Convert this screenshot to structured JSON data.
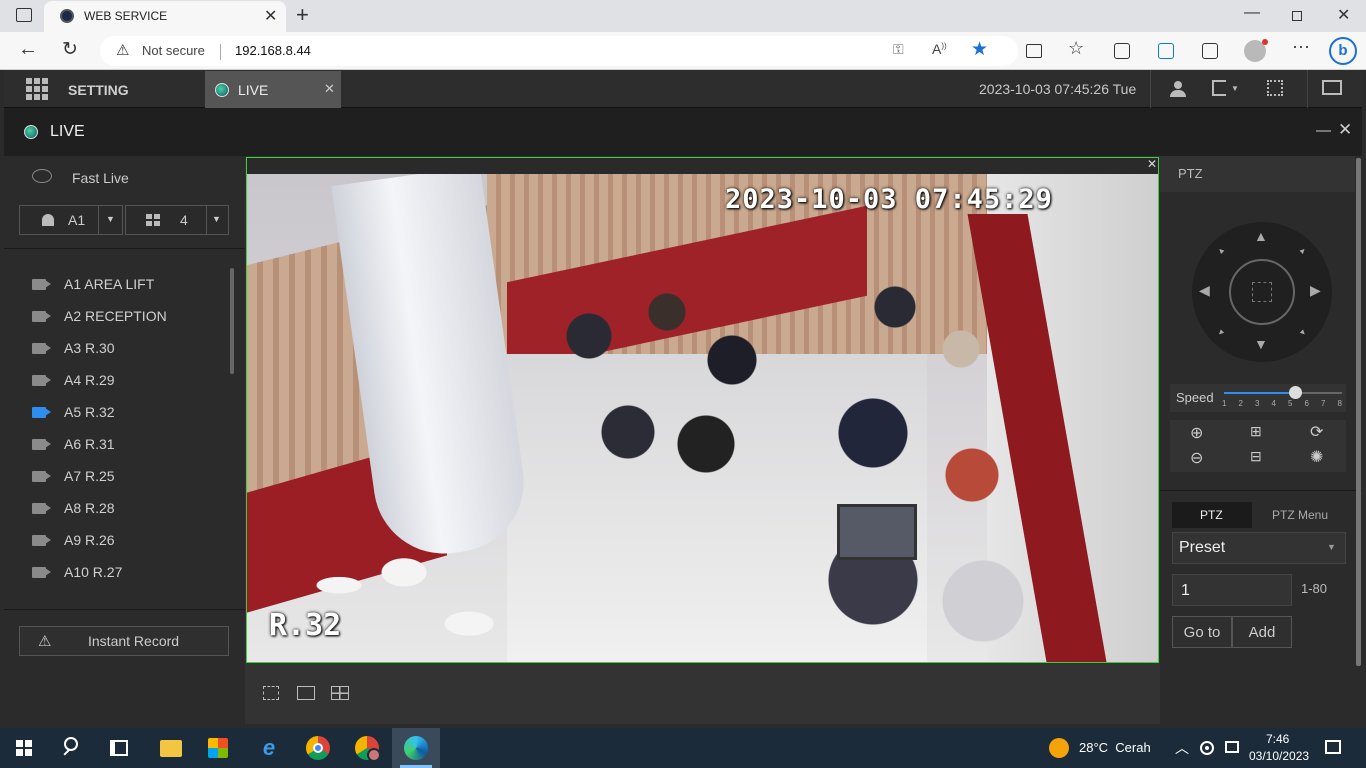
{
  "browser": {
    "tab_title": "WEB SERVICE",
    "security_label": "Not secure",
    "url": "192.168.8.44"
  },
  "app": {
    "nav": {
      "setting_label": "SETTING",
      "live_tab_label": "LIVE",
      "datetime": "2023-10-03 07:45:26 Tue"
    },
    "live_title": "LIVE",
    "left": {
      "fast_live_label": "Fast Live",
      "channel_select": "A1",
      "split_select": "4",
      "cameras": [
        {
          "label": "A1 AREA LIFT",
          "active": false
        },
        {
          "label": "A2 RECEPTION",
          "active": false
        },
        {
          "label": "A3 R.30",
          "active": false
        },
        {
          "label": "A4 R.29",
          "active": false
        },
        {
          "label": "A5 R.32",
          "active": true
        },
        {
          "label": "A6 R.31",
          "active": false
        },
        {
          "label": "A7 R.25",
          "active": false
        },
        {
          "label": "A8 R.28",
          "active": false
        },
        {
          "label": "A9 R.26",
          "active": false
        },
        {
          "label": "A10 R.27",
          "active": false
        }
      ],
      "instant_record_label": "Instant Record"
    },
    "video": {
      "timestamp_overlay": "2023-10-03 07:45:29",
      "room_overlay": "R.32"
    },
    "ptz": {
      "header": "PTZ",
      "speed_label": "Speed",
      "speed_ticks": [
        "1",
        "2",
        "3",
        "4",
        "5",
        "6",
        "7",
        "8"
      ],
      "speed_value": 5,
      "tab_ptz": "PTZ",
      "tab_ptz_menu": "PTZ Menu",
      "preset_select": "Preset",
      "preset_value": "1",
      "preset_range": "1-80",
      "goto_label": "Go to",
      "add_label": "Add"
    }
  },
  "taskbar": {
    "weather": "28°C  Cerah",
    "time": "7:46",
    "date": "03/10/2023"
  },
  "colors": {
    "accent_blue": "#2f8df0",
    "video_border": "#3bd13b"
  }
}
